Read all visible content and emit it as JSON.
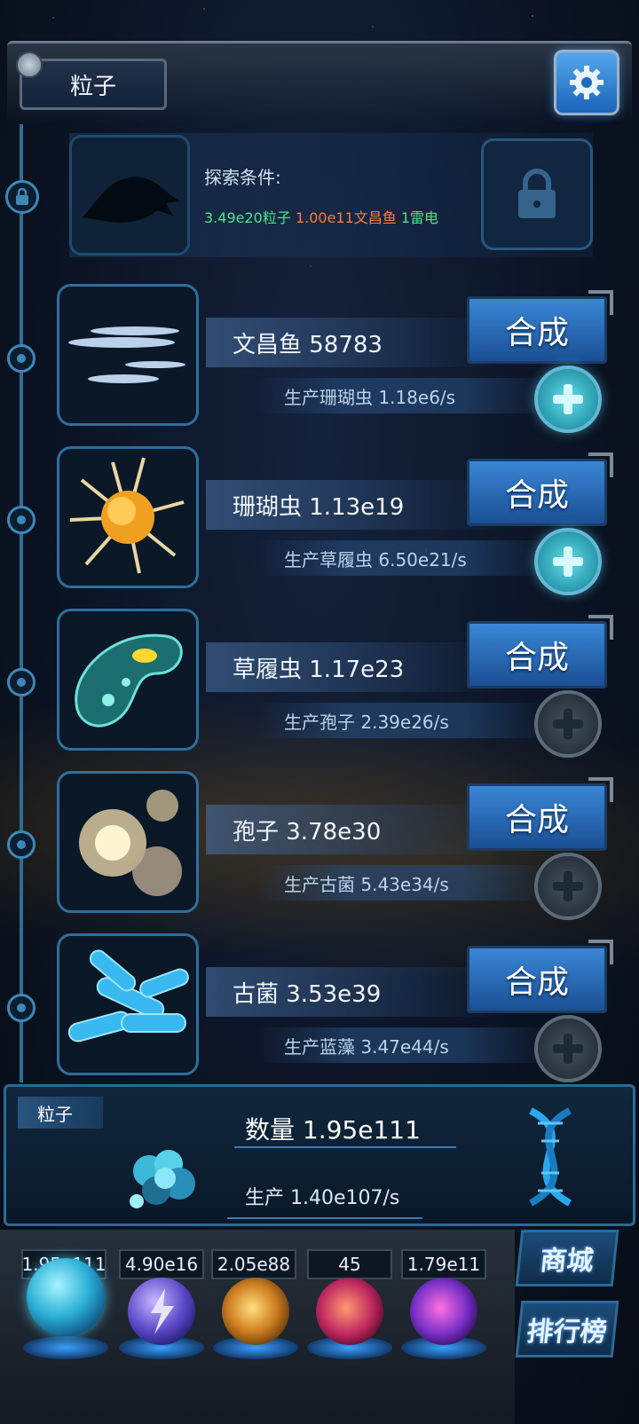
{
  "header": {
    "title": "粒子"
  },
  "locked": {
    "label": "探索条件:",
    "conditions": [
      {
        "text": "3.49e20粒子",
        "color": "#4fe08a"
      },
      {
        "text": "1.00e11文昌鱼",
        "color": "#ff7b3a"
      },
      {
        "text": "1雷电",
        "color": "#4fe08a"
      }
    ]
  },
  "rows": [
    {
      "name": "文昌鱼 58783",
      "prod": "生产珊瑚虫 1.18e6/s",
      "synth": "合成",
      "plus_active": true
    },
    {
      "name": "珊瑚虫 1.13e19",
      "prod": "生产草履虫 6.50e21/s",
      "synth": "合成",
      "plus_active": true
    },
    {
      "name": "草履虫 1.17e23",
      "prod": "生产孢子 2.39e26/s",
      "synth": "合成",
      "plus_active": false
    },
    {
      "name": "孢子 3.78e30",
      "prod": "生产古菌 5.43e34/s",
      "synth": "合成",
      "plus_active": false
    },
    {
      "name": "古菌 3.53e39",
      "prod": "生产蓝藻 3.47e44/s",
      "synth": "合成",
      "plus_active": false
    }
  ],
  "bottom": {
    "tab": "粒子",
    "count": "数量 1.95e111",
    "prod": "生产 1.40e107/s"
  },
  "currencies": [
    "1.95e111",
    "4.90e16",
    "2.05e88",
    "45",
    "1.79e11"
  ],
  "side_buttons": {
    "shop": "商城",
    "rank": "排行榜"
  }
}
